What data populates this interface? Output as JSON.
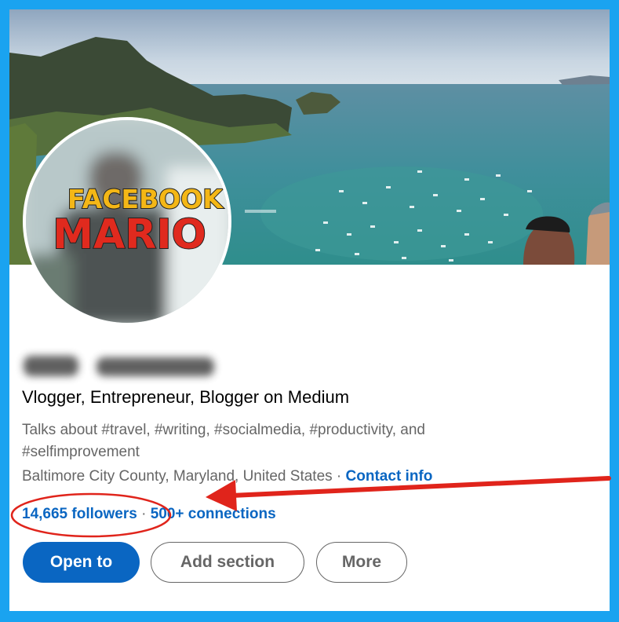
{
  "profile": {
    "headline": "Vlogger, Entrepreneur, Blogger on Medium",
    "about": "Talks about #travel, #writing, #socialmedia, #productivity, and #selfimprovement",
    "location": "Baltimore City County, Maryland, United States",
    "separator": " · ",
    "contact_info": "Contact info",
    "followers": "14,665 followers",
    "connections": "500+ connections",
    "avatar_text_line1": "FACEBOOK",
    "avatar_text_line2": "MARIO"
  },
  "actions": {
    "open_to": "Open to",
    "add_section": "Add section",
    "more": "More"
  },
  "colors": {
    "frame_border": "#1aa3f0",
    "link": "#0a66c2",
    "annotation": "#e0241b"
  }
}
